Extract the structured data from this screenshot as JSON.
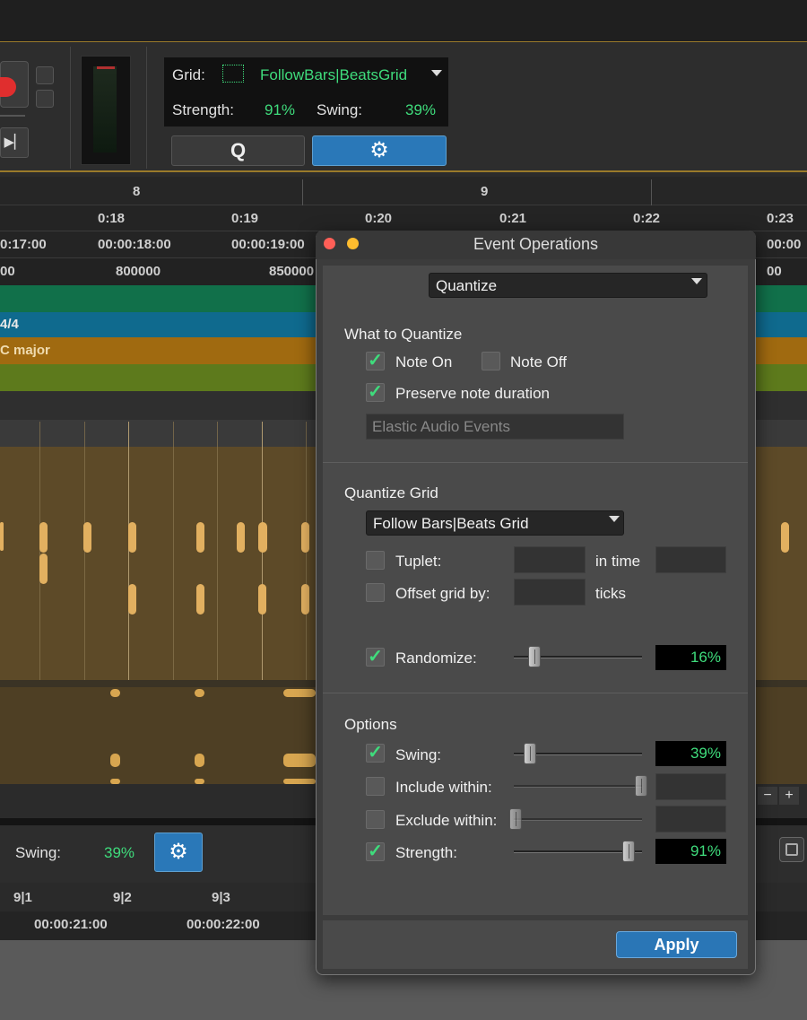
{
  "toolbar": {
    "grid_label": "Grid:",
    "grid_value": "FollowBars|BeatsGrid",
    "strength_label": "Strength:",
    "strength_value": "91%",
    "swing_label": "Swing:",
    "swing_value": "39%",
    "quantize_button": "Q",
    "accent_green": "#3fdc7c"
  },
  "ruler": {
    "bars": [
      "8",
      "9"
    ],
    "min_secs": [
      "0:18",
      "0:19",
      "0:20",
      "0:21",
      "0:22",
      "0:23"
    ],
    "timecode": [
      "0:17:00",
      "00:00:18:00",
      "00:00:19:00",
      "00:00"
    ],
    "samples": [
      "00",
      "800000",
      "850000",
      "00"
    ]
  },
  "lanes": {
    "meter": "4/4",
    "key": "C major"
  },
  "lower": {
    "swing_label": "Swing:",
    "swing_value": "39%",
    "bars": [
      "9|1",
      "9|2",
      "9|3"
    ],
    "timecode": [
      "00:00:21:00",
      "00:00:22:00"
    ],
    "zoom_minus": "−",
    "zoom_plus": "+"
  },
  "dialog": {
    "title": "Event Operations",
    "operation": "Quantize",
    "what_section": "What to Quantize",
    "note_on": "Note On",
    "note_on_checked": true,
    "note_off": "Note Off",
    "note_off_checked": false,
    "preserve": "Preserve note duration",
    "preserve_checked": true,
    "elastic_placeholder": "Elastic Audio Events",
    "grid_section": "Quantize Grid",
    "grid_select": "Follow Bars|Beats Grid",
    "tuplet": "Tuplet:",
    "in_time": "in time",
    "offset": "Offset grid by:",
    "ticks": "ticks",
    "randomize": "Randomize:",
    "randomize_checked": true,
    "randomize_value": "16%",
    "randomize_level": 0.16,
    "options_section": "Options",
    "swing": "Swing:",
    "swing_checked": true,
    "swing_value": "39%",
    "swing_level": 0.39,
    "include": "Include within:",
    "include_checked": false,
    "exclude": "Exclude within:",
    "exclude_checked": false,
    "strength": "Strength:",
    "strength_checked": true,
    "strength_value": "91%",
    "strength_level": 0.91,
    "apply": "Apply",
    "check_mark": "✓"
  }
}
